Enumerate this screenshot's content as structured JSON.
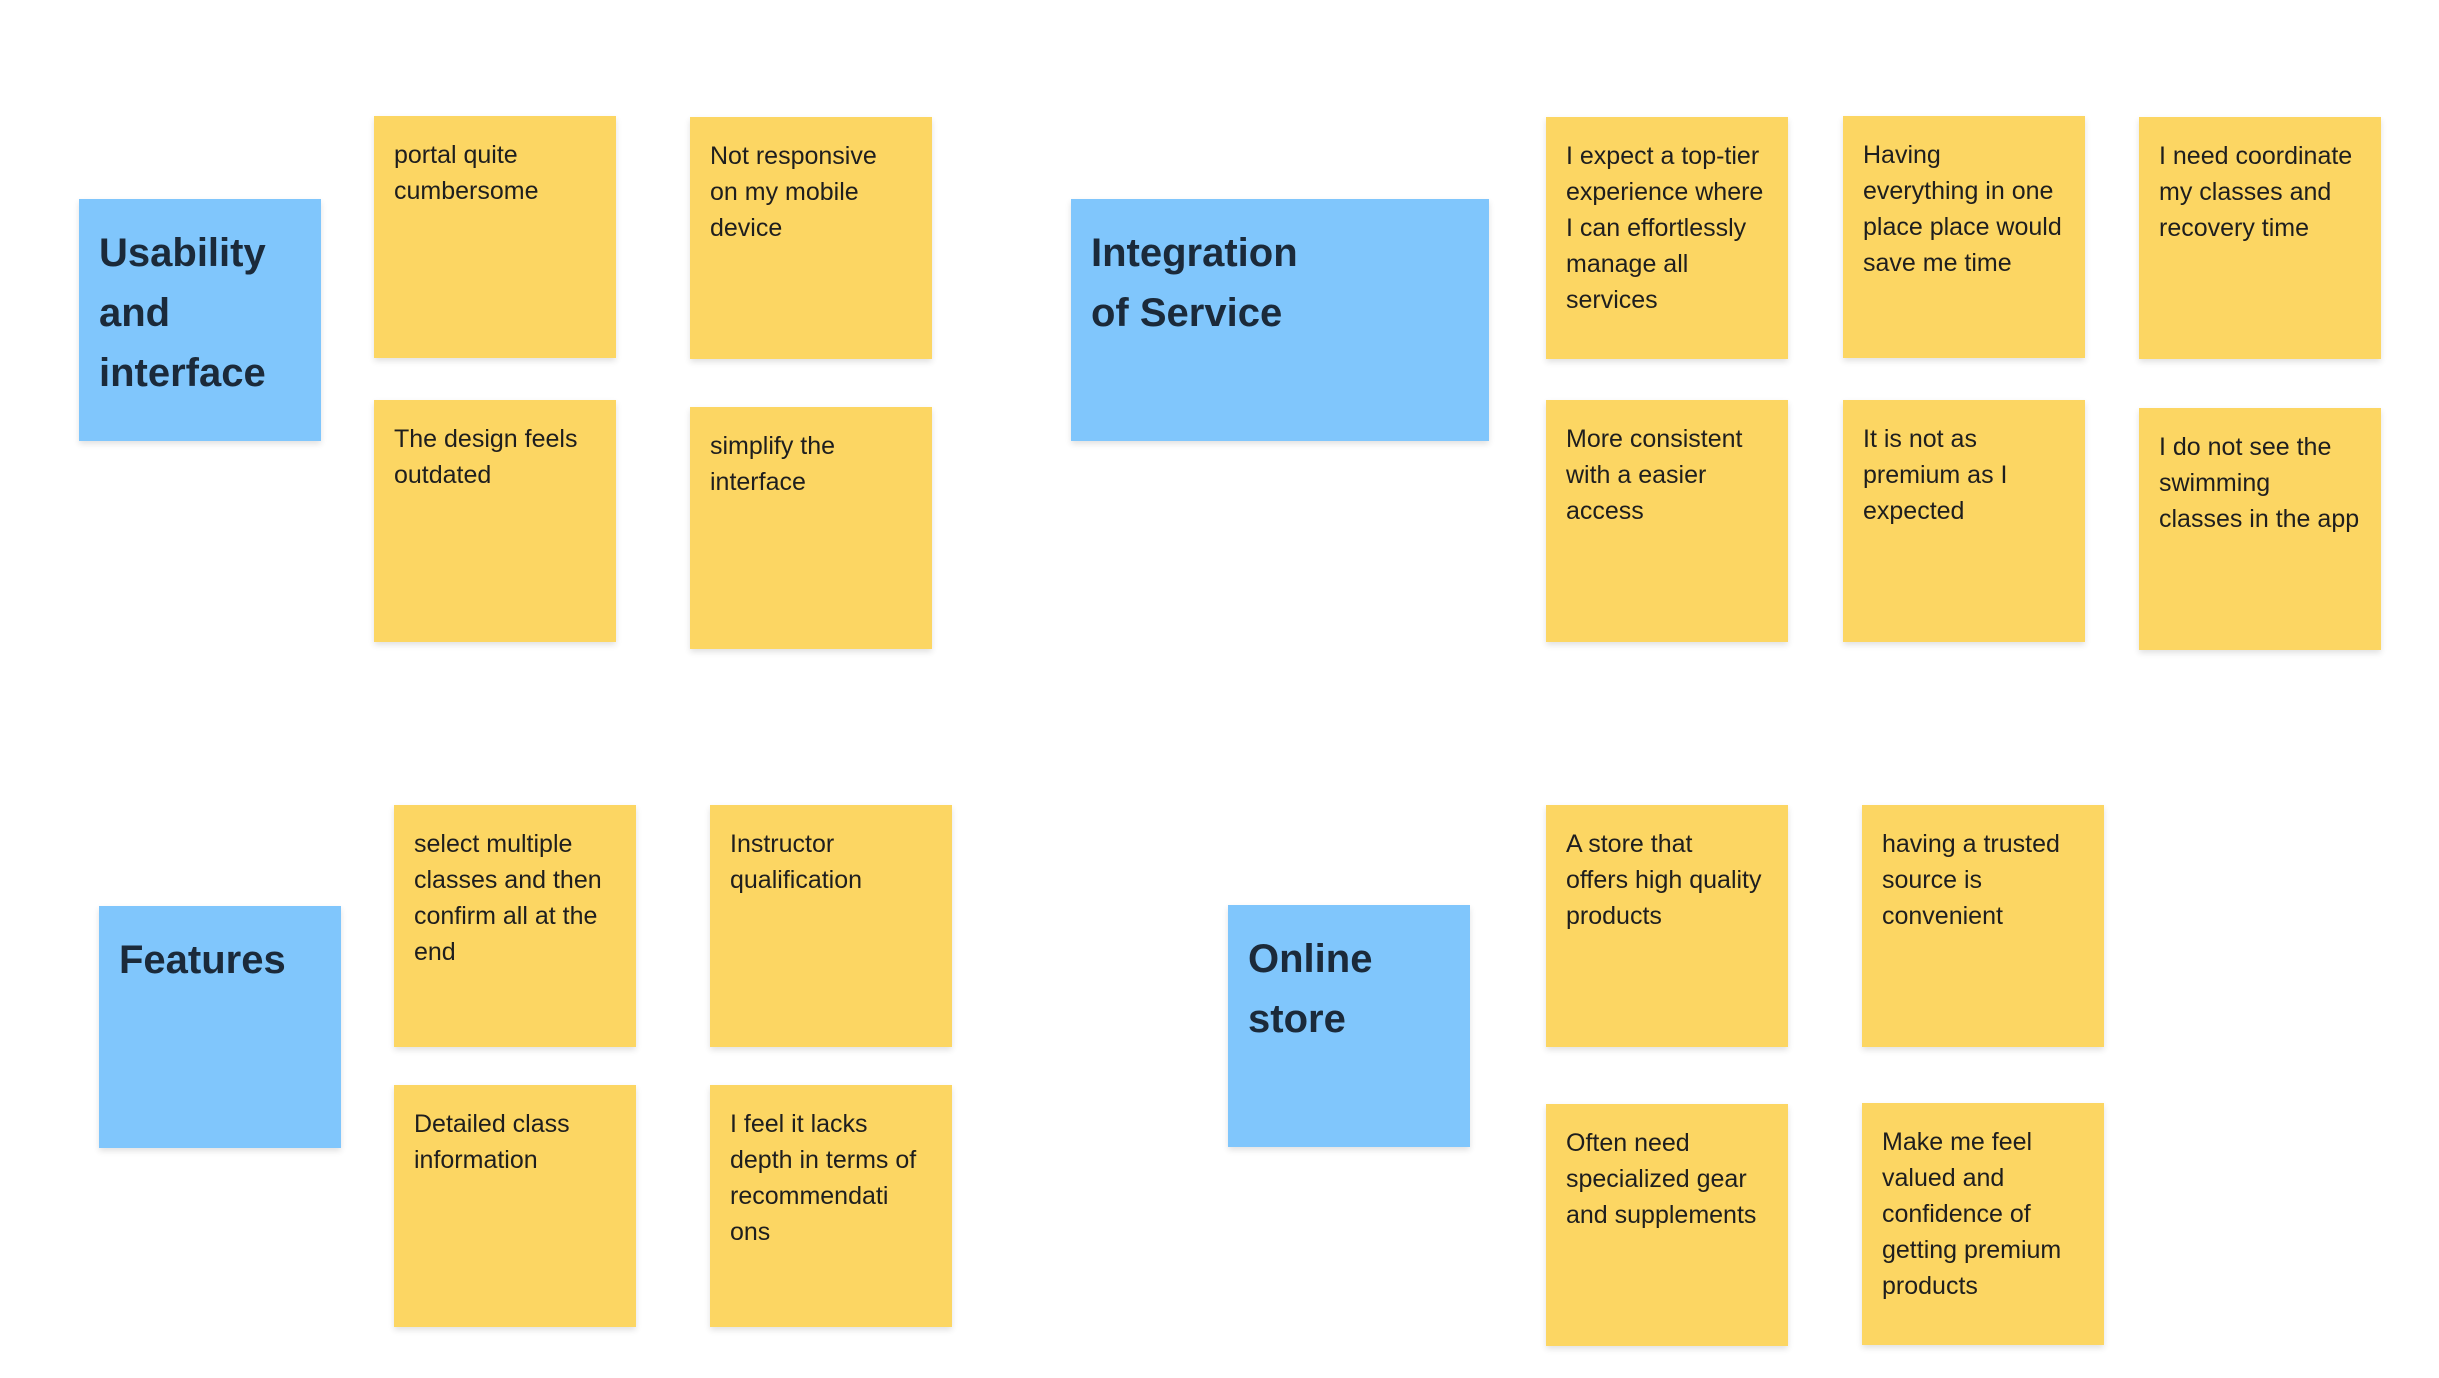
{
  "colors": {
    "header": "#80C6FC",
    "sticky": "#FCD663",
    "background": "#FFFFFF"
  },
  "clusters": {
    "usability": {
      "title": "Usability\nand\ninterface",
      "notes": [
        "portal quite\ncumbersome",
        "Not responsive\non my mobile\ndevice",
        "The design feels\noutdated",
        "simplify the\ninterface"
      ]
    },
    "integration": {
      "title": "Integration\nof Service",
      "notes": [
        "I expect a top-tier\nexperience where\nI can effortlessly\nmanage all\nservices",
        "Having\neverything in one\nplace place would\nsave me time",
        "I need coordinate\nmy classes and\nrecovery time",
        "More consistent\nwith a easier\naccess",
        "It is not as\npremium as I\nexpected",
        "I do not see the\nswimming\nclasses in the app"
      ]
    },
    "features": {
      "title": "Features",
      "notes": [
        "select multiple\nclasses and then\nconfirm all at the\nend",
        "Instructor\nqualification",
        "Detailed class\ninformation",
        "I feel it lacks\ndepth in terms of\nrecommendati\nons"
      ]
    },
    "online_store": {
      "title": "Online\nstore",
      "notes": [
        "A store that\noffers high quality\nproducts",
        "having a trusted\nsource is\nconvenient",
        "Often need\nspecialized gear\nand supplements",
        "Make me feel\nvalued and\nconfidence of\ngetting premium\nproducts"
      ]
    }
  }
}
